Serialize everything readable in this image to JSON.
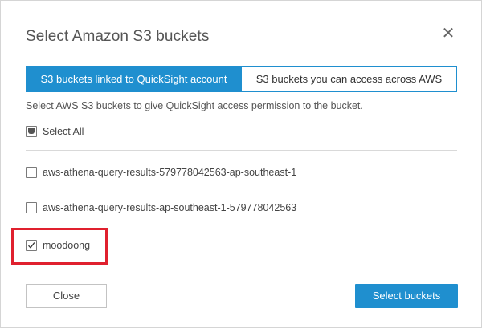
{
  "dialog": {
    "title": "Select Amazon S3 buckets",
    "close_icon": "close-icon",
    "tabs": [
      {
        "label": "S3 buckets linked to QuickSight account",
        "active": true
      },
      {
        "label": "S3 buckets you can access across AWS",
        "active": false
      }
    ],
    "description": "Select AWS S3 buckets to give QuickSight access permission to the bucket.",
    "select_all": {
      "label": "Select All",
      "state": "partial"
    },
    "buckets": [
      {
        "label": "aws-athena-query-results-579778042563-ap-southeast-1",
        "checked": false
      },
      {
        "label": "aws-athena-query-results-ap-southeast-1-579778042563",
        "checked": false
      },
      {
        "label": "moodoong",
        "checked": true
      }
    ],
    "buttons": {
      "close_label": "Close",
      "select_label": "Select buckets"
    }
  },
  "colors": {
    "accent": "#1f8fcf",
    "highlight": "#e0202e",
    "divider": "#d9d9d9"
  }
}
